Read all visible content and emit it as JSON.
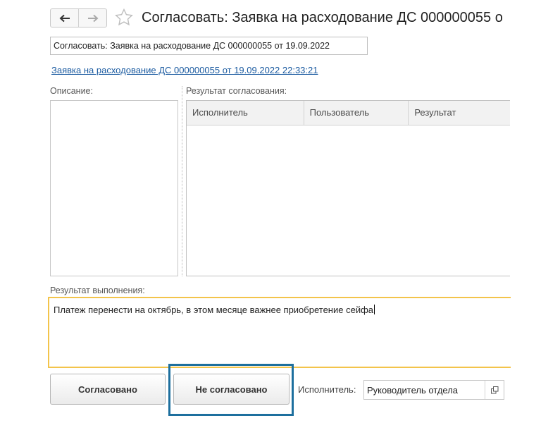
{
  "header": {
    "back_icon": "arrow-left-icon",
    "forward_icon": "arrow-right-icon",
    "favorite_icon": "star-outline-icon",
    "title": "Согласовать: Заявка на расходование ДС 000000055 о"
  },
  "subject_field": {
    "value": "Согласовать: Заявка на расходование ДС 000000055 от 19.09.2022"
  },
  "document_link": "Заявка на расходование ДС 000000055 от 19.09.2022 22:33:21",
  "description": {
    "label": "Описание:"
  },
  "approval_results": {
    "label": "Результат согласования:",
    "columns": [
      "Исполнитель",
      "Пользователь",
      "Результат"
    ],
    "rows": []
  },
  "execution_result": {
    "label": "Результат выполнения:",
    "value": "Платеж перенести на октябрь, в этом месяце важнее приобретение сейфа"
  },
  "buttons": {
    "approved": "Согласовано",
    "not_approved": "Не согласовано"
  },
  "executor": {
    "label": "Исполнитель:",
    "value": "Руководитель отдела",
    "open_icon": "open-in-window-icon"
  },
  "colors": {
    "accent_border": "#f3c44b",
    "highlight_frame": "#1d6f9e",
    "link": "#1a5aa0"
  }
}
